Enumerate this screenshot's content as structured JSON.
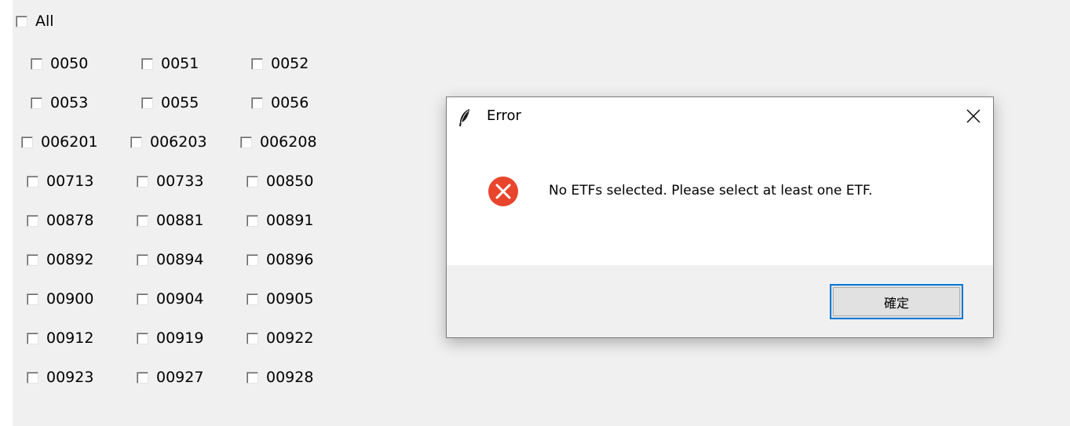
{
  "checkbox_panel": {
    "all_label": "All",
    "rows": [
      [
        "0050",
        "0051",
        "0052"
      ],
      [
        "0053",
        "0055",
        "0056"
      ],
      [
        "006201",
        "006203",
        "006208"
      ],
      [
        "00713",
        "00733",
        "00850"
      ],
      [
        "00878",
        "00881",
        "00891"
      ],
      [
        "00892",
        "00894",
        "00896"
      ],
      [
        "00900",
        "00904",
        "00905"
      ],
      [
        "00912",
        "00919",
        "00922"
      ],
      [
        "00923",
        "00927",
        "00928"
      ]
    ]
  },
  "dialog": {
    "title": "Error",
    "message": "No ETFs selected. Please select at least one ETF.",
    "ok_label": "確定",
    "icon": "error-icon",
    "title_icon": "feather-icon",
    "close_icon": "close-icon"
  },
  "colors": {
    "window_bg": "#f0f0f0",
    "error_red": "#e8452c",
    "focus_blue": "#0078d7"
  }
}
